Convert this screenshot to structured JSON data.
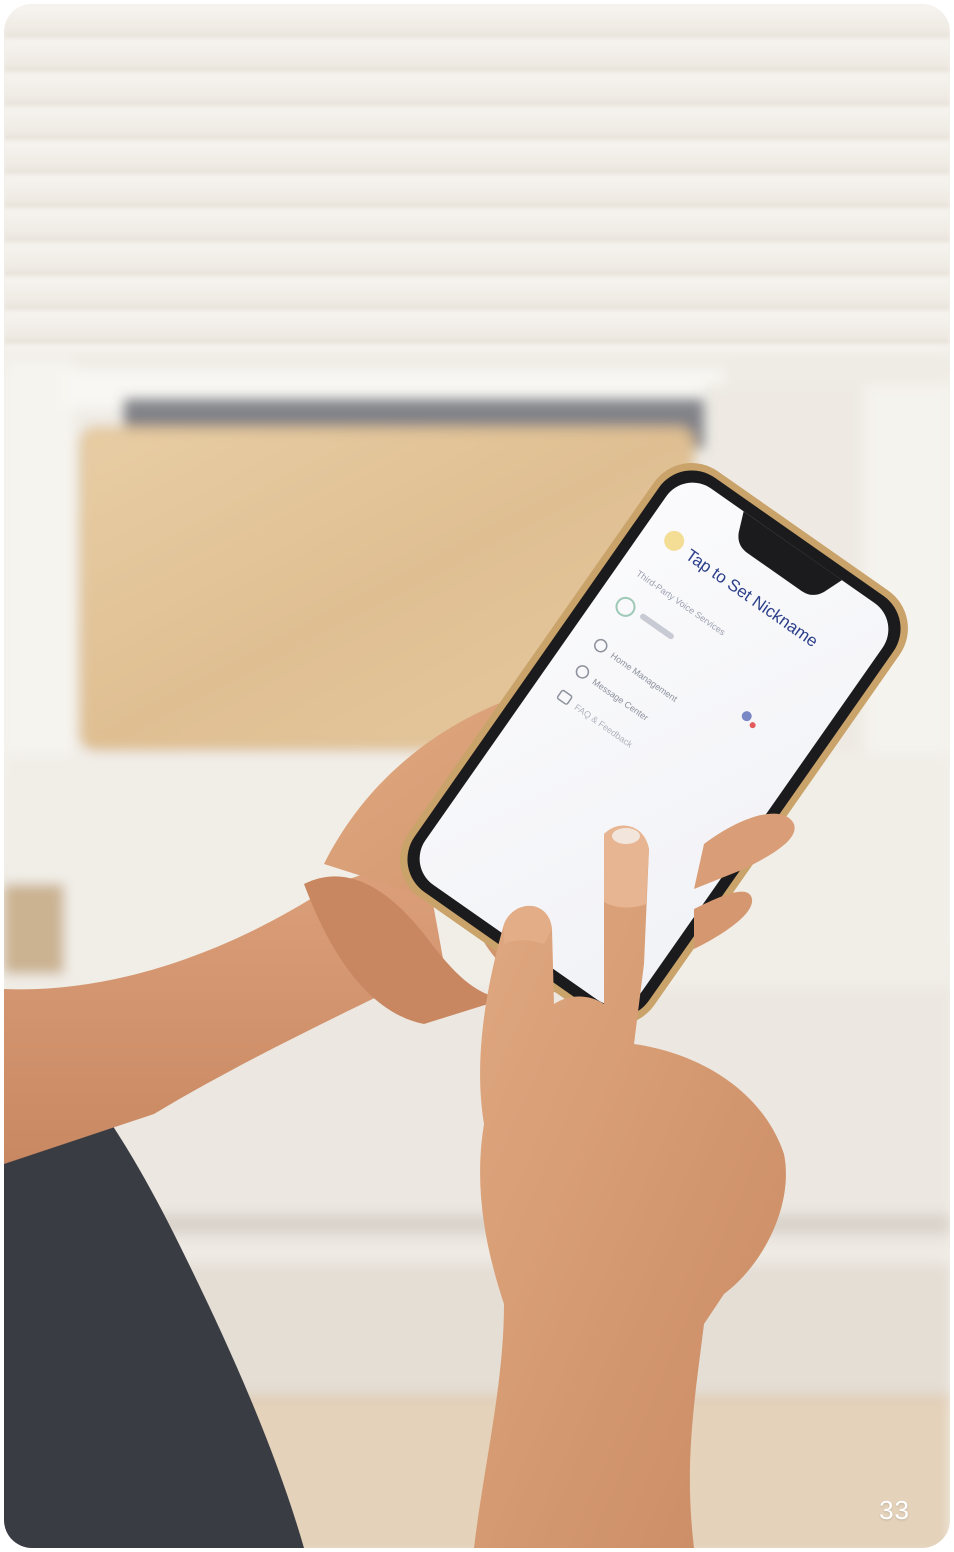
{
  "photo": {
    "scene": "Person using a smartphone app in front of a window air conditioner",
    "colors": {
      "blinds": "#f2efe9",
      "wall": "#ece6dc",
      "ac_panel": "#e2c59a",
      "skin": "#d49b74",
      "shirt": "#3b3d44",
      "phone_frame": "#c9a36a"
    }
  },
  "phone_screen": {
    "title": "Tap to Set Nickname",
    "section_label": "Third-Party Voice Services",
    "items": [
      {
        "label": "Home Management",
        "icon": "home-icon"
      },
      {
        "label": "Message Center",
        "icon": "message-icon"
      },
      {
        "label": "FAQ & Feedback",
        "icon": "help-icon"
      }
    ]
  },
  "page_number": "33"
}
